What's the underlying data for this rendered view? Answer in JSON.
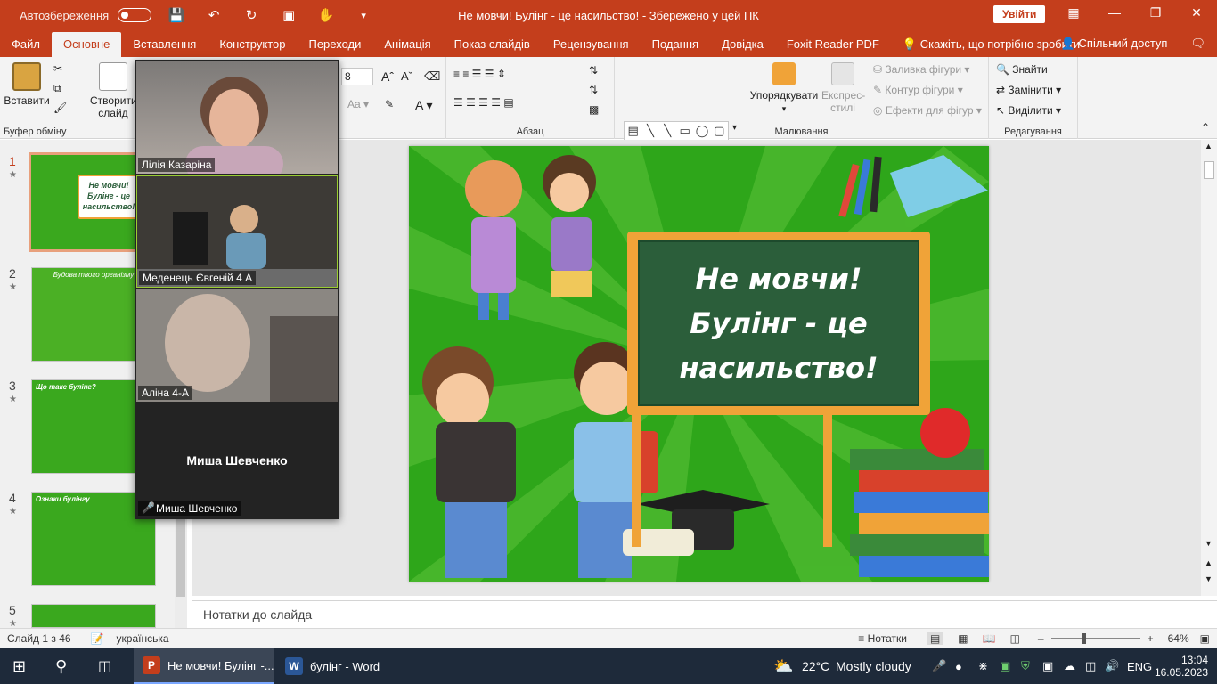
{
  "colors": {
    "accent": "#c43e1c",
    "slide_bg": "#2ea61a",
    "board": "#2b5e3a",
    "taskbar": "#1e2a3a"
  },
  "titlebar": {
    "autosave_label": "Автозбереження",
    "doc_title": "Не мовчи! Булінг - це насильство!  -  Збережено у цей ПК",
    "signin_label": "Увійти"
  },
  "tabs": [
    "Файл",
    "Основне",
    "Вставлення",
    "Конструктор",
    "Переходи",
    "Анімація",
    "Показ слайдів",
    "Рецензування",
    "Подання",
    "Довідка",
    "Foxit Reader PDF"
  ],
  "tell_me": "Скажіть, що потрібно зробити",
  "share_label": "Спільний доступ",
  "ribbon": {
    "clipboard": {
      "paste": "Вставити",
      "group": "Буфер обміну"
    },
    "slides": {
      "new_slide_line1": "Створити",
      "new_slide_line2": "слайд"
    },
    "font_size": "8",
    "paragraph_group": "Абзац",
    "drawing": {
      "arrange": "Упорядкувати",
      "quick_styles_line1": "Експрес-",
      "quick_styles_line2": "стилі",
      "fill": "Заливка фігури",
      "outline": "Контур фігури",
      "effects": "Ефекти для фігур",
      "group": "Малювання"
    },
    "editing": {
      "find": "Знайти",
      "replace": "Замінити",
      "select": "Виділити",
      "group": "Редагування"
    }
  },
  "thumbnails": [
    {
      "num": "1",
      "title": "Не мовчи! Булінг - це насильство!"
    },
    {
      "num": "2",
      "title": "Будова твого організму"
    },
    {
      "num": "3",
      "title": "Що таке булінг?"
    },
    {
      "num": "4",
      "title": "Ознаки булінгу"
    },
    {
      "num": "5",
      "title": ""
    }
  ],
  "slide": {
    "line1": "Не мовчи!",
    "line2": "Булінг - це",
    "line3": "насильство!"
  },
  "notes_placeholder": "Нотатки до слайда",
  "zoom": {
    "participants": [
      {
        "name": "Лілія Казаріна"
      },
      {
        "name": "Меденець Євгеній 4 А"
      },
      {
        "name": "Аліна 4-А"
      },
      {
        "name": "Миша Шевченко",
        "center_name": "Миша Шевченко"
      }
    ]
  },
  "status": {
    "slide_counter": "Слайд 1 з 46",
    "language": "українська",
    "notes_btn": "Нотатки",
    "zoom_level": "64%"
  },
  "taskbar": {
    "apps": [
      {
        "label": "Не мовчи! Булінг -...",
        "icon": "P"
      },
      {
        "label": "булінг - Word",
        "icon": "W"
      }
    ],
    "weather_temp": "22°C",
    "weather_desc": "Mostly cloudy",
    "lang": "ENG",
    "time": "13:04",
    "date": "16.05.2023"
  }
}
